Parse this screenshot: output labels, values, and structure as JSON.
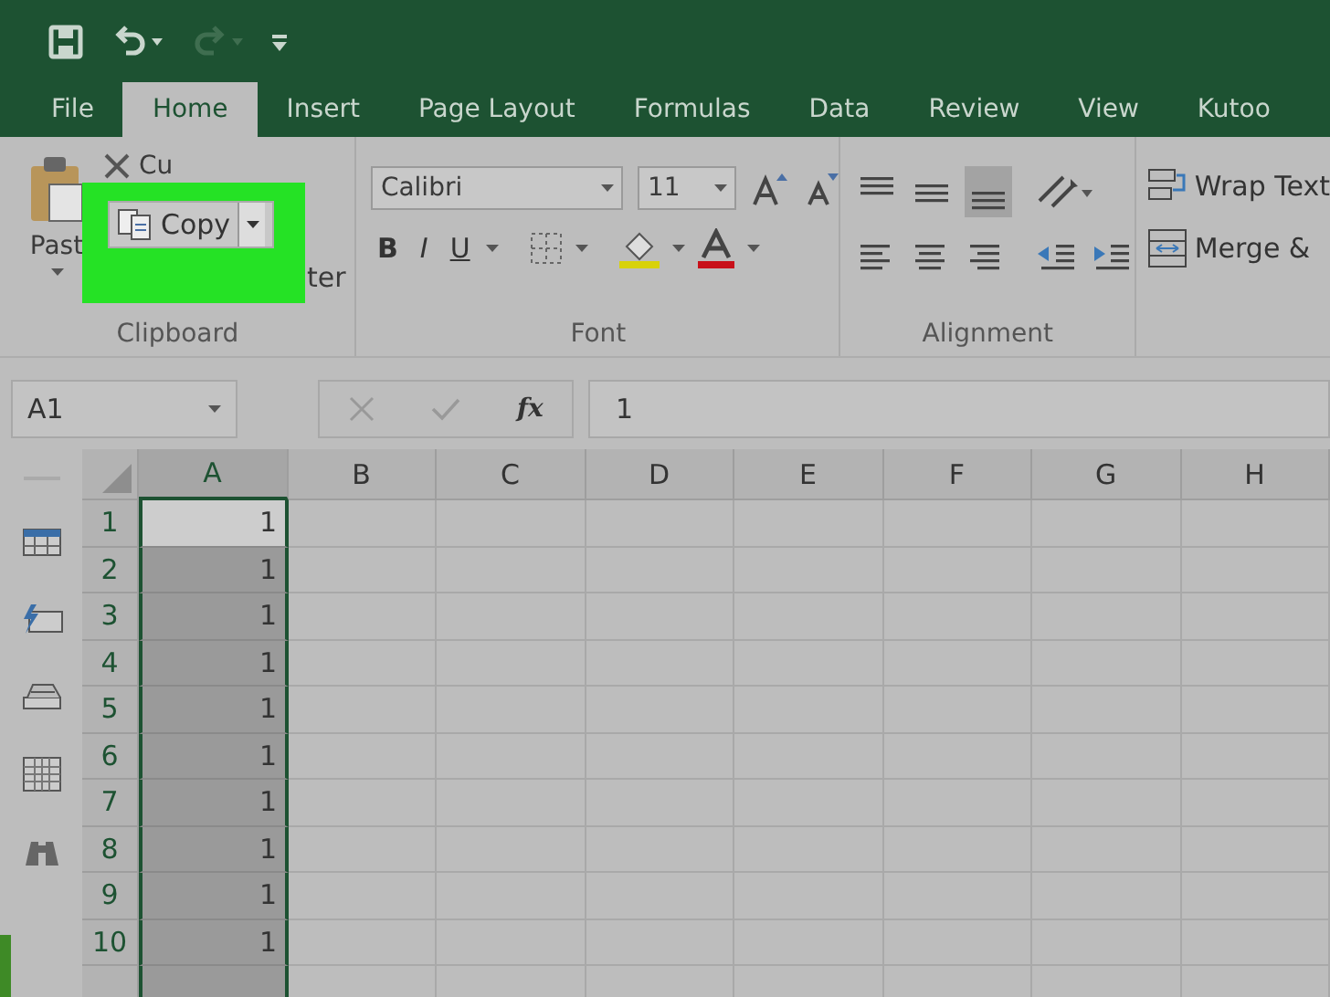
{
  "quick_access": {
    "undo_enabled": true,
    "redo_enabled": false
  },
  "tabs": [
    {
      "label": "File",
      "selected": false
    },
    {
      "label": "Home",
      "selected": true
    },
    {
      "label": "Insert",
      "selected": false
    },
    {
      "label": "Page Layout",
      "selected": false
    },
    {
      "label": "Formulas",
      "selected": false
    },
    {
      "label": "Data",
      "selected": false
    },
    {
      "label": "Review",
      "selected": false
    },
    {
      "label": "View",
      "selected": false
    },
    {
      "label": "Kutoo",
      "selected": false
    }
  ],
  "clipboard": {
    "paste_label": "Past",
    "cut_label": "Cu",
    "copy_label": "Copy",
    "format_painter_label": "ter",
    "group_label": "Clipboard"
  },
  "font": {
    "name": "Calibri",
    "size": "11",
    "style_buttons": [
      "B",
      "I",
      "U"
    ],
    "group_label": "Font"
  },
  "alignment": {
    "group_label": "Alignment",
    "wrap_text": "Wrap Text",
    "merge": "Merge &"
  },
  "formula_bar": {
    "name_box": "A1",
    "function_label": "fx",
    "value": "1"
  },
  "sheet": {
    "columns": [
      {
        "label": "A",
        "selected": true
      },
      {
        "label": "B",
        "selected": false
      },
      {
        "label": "C",
        "selected": false
      },
      {
        "label": "D",
        "selected": false
      },
      {
        "label": "E",
        "selected": false
      },
      {
        "label": "F",
        "selected": false
      },
      {
        "label": "G",
        "selected": false
      },
      {
        "label": "H",
        "selected": false
      }
    ],
    "rows": [
      {
        "label": "1",
        "a": "1",
        "active": true
      },
      {
        "label": "2",
        "a": "1",
        "active": false
      },
      {
        "label": "3",
        "a": "1",
        "active": false
      },
      {
        "label": "4",
        "a": "1",
        "active": false
      },
      {
        "label": "5",
        "a": "1",
        "active": false
      },
      {
        "label": "6",
        "a": "1",
        "active": false
      },
      {
        "label": "7",
        "a": "1",
        "active": false
      },
      {
        "label": "8",
        "a": "1",
        "active": false
      },
      {
        "label": "9",
        "a": "1",
        "active": false
      },
      {
        "label": "10",
        "a": "1",
        "active": false
      }
    ]
  }
}
